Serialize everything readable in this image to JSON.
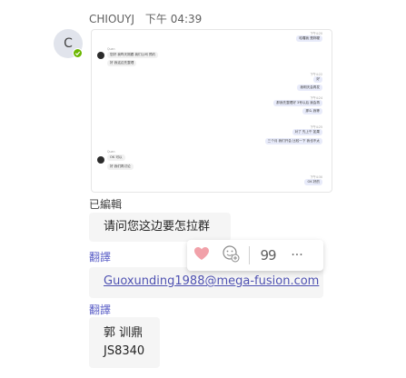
{
  "message": {
    "sender": "CHIOUYJ",
    "timestamp": "下午 04:39",
    "avatar_initial": "C",
    "presence": "available",
    "edited_label": "已編輯",
    "text": "请问您这边要怎拉群",
    "translate_label": "翻譯"
  },
  "attachment": {
    "screenshot": {
      "right_bubbles": [
        "哈囉我 是妳喔",
        "好",
        "我明天会再发",
        "那我先整理好 3号以后 我会再",
        "那么 我等",
        "对了 先上午 如果",
        "三个月 我们开会 比较一下 我也不太"
      ],
      "left_bubbles": [
        "您好 我昨天刚跟 我们公司 预约",
        "好 我这边先整理",
        "OK 可以",
        "好 我们再讨论"
      ],
      "left_sender": "Quan",
      "last_right": "OK 好的"
    }
  },
  "email_message": {
    "link_text": "Guoxunding1988@mega-fusion.com",
    "translate_label": "翻譯"
  },
  "contact_message": {
    "line1": "郭 训鼎",
    "line2": "JS8340"
  },
  "toolbar": {
    "like_icon": "heart-icon",
    "emoji_icon": "add-reaction-icon",
    "quote_label": "99",
    "more_label": "···"
  },
  "colors": {
    "accent": "#5b5fc7",
    "link": "#4f52b2",
    "bubble": "#f5f5f5",
    "presence": "#6bb700",
    "heart": "#f1a1a9"
  }
}
